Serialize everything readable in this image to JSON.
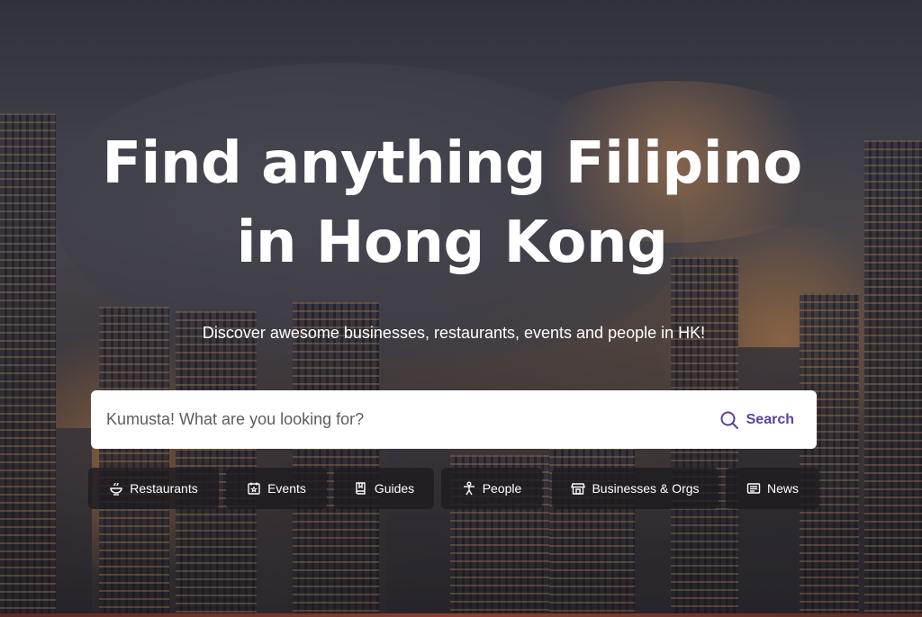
{
  "hero": {
    "title_line1": "Find anything Filipino",
    "title_line2": "in Hong Kong",
    "subtitle": "Discover awesome businesses, restaurants, events and people in HK!"
  },
  "search": {
    "placeholder": "Kumusta! What are you looking for?",
    "value": "",
    "button_label": "Search",
    "button_icon": "search-icon"
  },
  "categories": [
    {
      "label": "Restaurants",
      "icon": "bowl-icon"
    },
    {
      "label": "Events",
      "icon": "calendar-star-icon"
    },
    {
      "label": "Guides",
      "icon": "book-icon"
    },
    {
      "label": "People",
      "icon": "person-icon"
    },
    {
      "label": "Businesses & Orgs",
      "icon": "store-icon"
    },
    {
      "label": "News",
      "icon": "newspaper-icon"
    }
  ],
  "colors": {
    "accent": "#5b3fa0",
    "chip_background": "#1e1c21",
    "text_on_dark": "#ffffff"
  }
}
